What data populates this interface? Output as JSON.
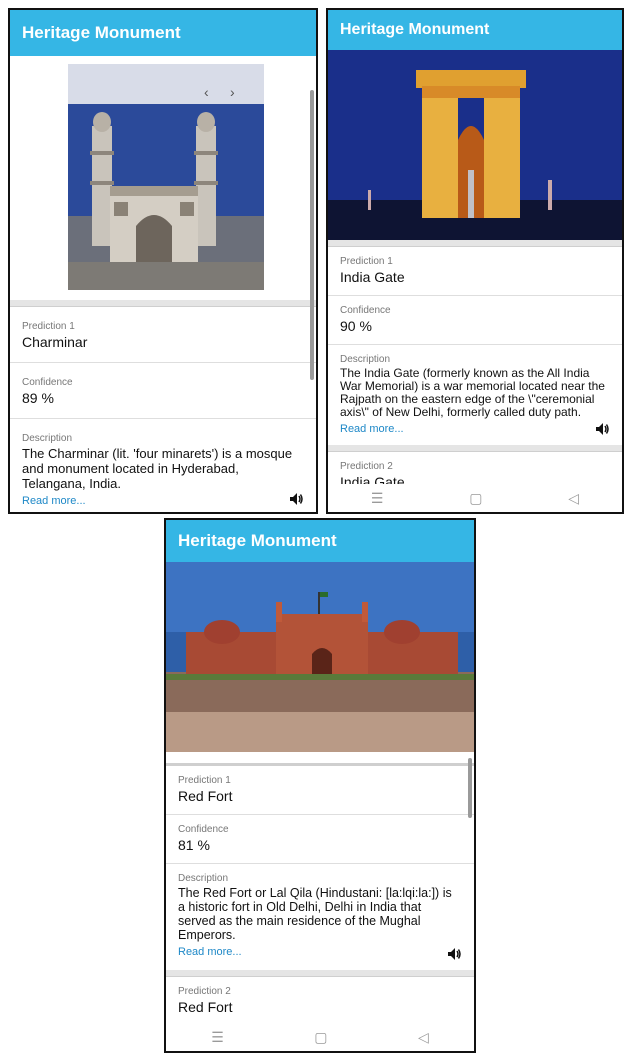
{
  "screens": [
    {
      "title": "Heritage Monument",
      "prediction_label": "Prediction 1",
      "prediction_value": "Charminar",
      "confidence_label": "Confidence",
      "confidence_value": "89 %",
      "description_label": "Description",
      "description_text": "The Charminar (lit. 'four minarets') is a mosque and monument located in Hyderabad, Telangana, India.",
      "read_more": "Read more..."
    },
    {
      "title": "Heritage Monument",
      "prediction_label": "Prediction 1",
      "prediction_value": "India Gate",
      "confidence_label": "Confidence",
      "confidence_value": "90 %",
      "description_label": "Description",
      "description_text": "The India Gate (formerly known as the All India War Memorial) is a war memorial located near the Rajpath on the eastern edge of the \\\"ceremonial axis\\\" of New Delhi, formerly called duty path.",
      "read_more": "Read more...",
      "prediction2_label": "Prediction 2",
      "prediction2_value": "India Gate"
    },
    {
      "title": "Heritage Monument",
      "prediction_label": "Prediction 1",
      "prediction_value": "Red Fort",
      "confidence_label": "Confidence",
      "confidence_value": "81 %",
      "description_label": "Description",
      "description_text": "The Red Fort or Lal Qila (Hindustani: [la:lqi:la:]) is a historic fort in Old Delhi, Delhi in India that served as the main residence of the Mughal Emperors.",
      "read_more": "Read more...",
      "prediction2_label": "Prediction 2",
      "prediction2_value": "Red Fort"
    }
  ],
  "icons": {
    "speaker": "speaker-icon",
    "nav_menu": "menu-icon",
    "nav_home": "home-icon",
    "nav_back": "back-icon",
    "carousel_prev": "chevron-left-icon",
    "carousel_next": "chevron-right-icon"
  },
  "colors": {
    "appbar": "#35b6e5",
    "link": "#1e88c7"
  }
}
